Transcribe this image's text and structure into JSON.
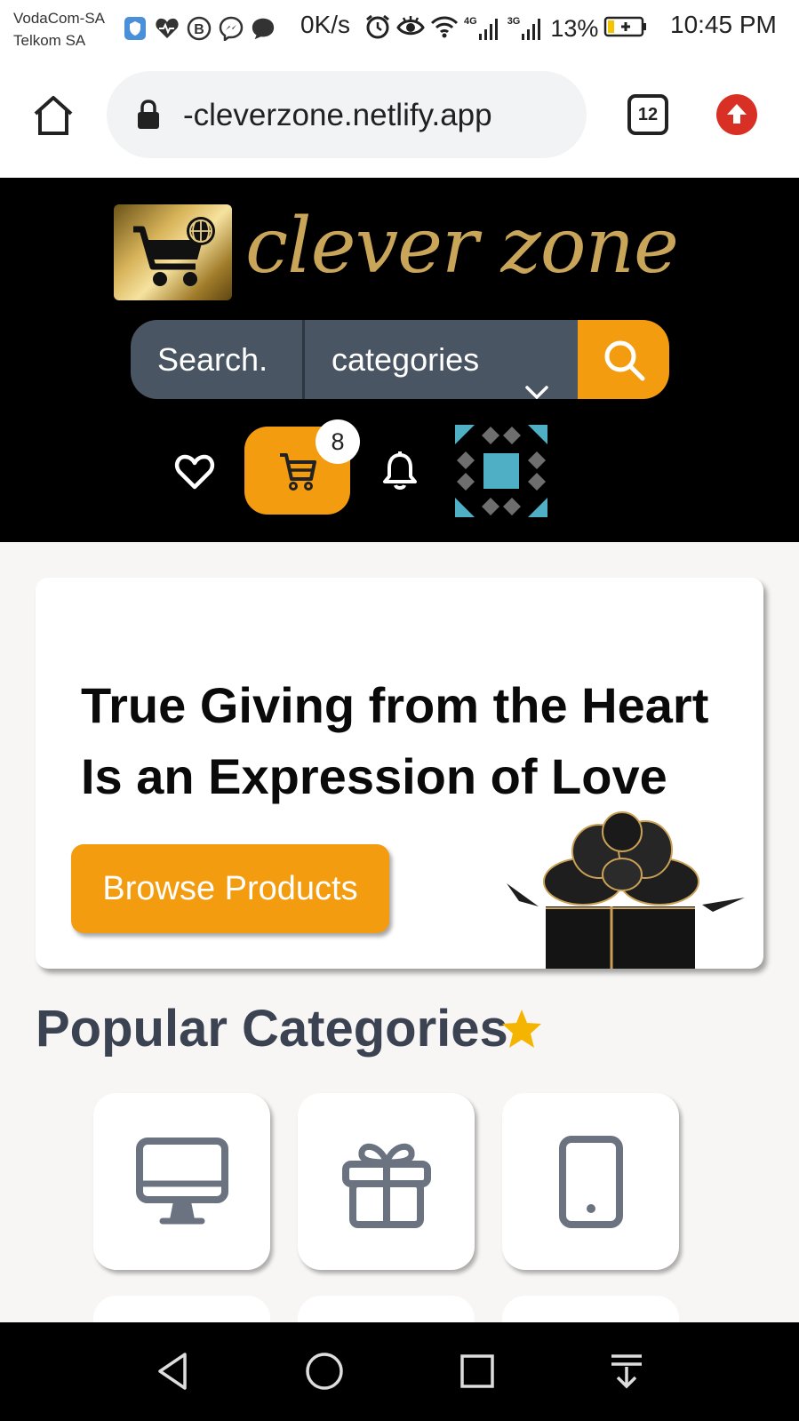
{
  "status_bar": {
    "carrier_1": "VodaCom-SA",
    "carrier_2": "Telkom SA",
    "net_speed": "0K/s",
    "net_4g": "4G",
    "net_3g": "3G",
    "battery": "13%",
    "time": "10:45 PM",
    "icons": [
      "shield-icon",
      "heart-pulse-icon",
      "b-circle-icon",
      "messenger-icon",
      "chat-bubble-icon",
      "alarm-icon",
      "eye-icon",
      "wifi-icon",
      "signal-icon",
      "battery-icon"
    ]
  },
  "browser": {
    "url": "-cleverzone.netlify.app",
    "tab_count": "12",
    "icons": [
      "home-icon",
      "lock-icon",
      "tabs-icon",
      "update-arrow-icon"
    ]
  },
  "header": {
    "logo_text": "clever zone",
    "search_placeholder": "Search.",
    "category_label": "categories",
    "cart_count": "8",
    "accent_color": "#f39c0f",
    "icons": [
      "cart-globe-icon",
      "chevron-down-icon",
      "search-icon",
      "heart-icon",
      "cart-icon",
      "bell-icon",
      "avatar-pattern"
    ]
  },
  "hero": {
    "title": "True Giving from the Heart Is an Expression of Love",
    "button_label": "Browse Products"
  },
  "popular": {
    "title": "Popular Categories",
    "categories": [
      {
        "icon": "desktop-icon"
      },
      {
        "icon": "gift-icon"
      },
      {
        "icon": "mobile-phone-icon"
      }
    ]
  },
  "nav": {
    "icons": [
      "back-triangle-icon",
      "home-circle-icon",
      "recents-square-icon",
      "notification-pull-icon"
    ]
  }
}
